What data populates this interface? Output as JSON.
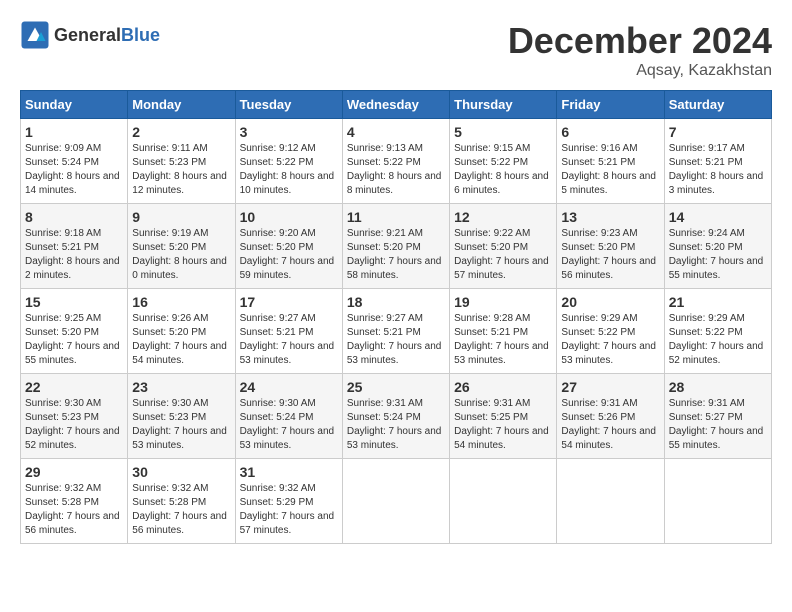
{
  "header": {
    "logo_general": "General",
    "logo_blue": "Blue",
    "month_year": "December 2024",
    "location": "Aqsay, Kazakhstan"
  },
  "weekdays": [
    "Sunday",
    "Monday",
    "Tuesday",
    "Wednesday",
    "Thursday",
    "Friday",
    "Saturday"
  ],
  "weeks": [
    [
      {
        "day": "1",
        "sunrise": "9:09 AM",
        "sunset": "5:24 PM",
        "daylight": "8 hours and 14 minutes."
      },
      {
        "day": "2",
        "sunrise": "9:11 AM",
        "sunset": "5:23 PM",
        "daylight": "8 hours and 12 minutes."
      },
      {
        "day": "3",
        "sunrise": "9:12 AM",
        "sunset": "5:22 PM",
        "daylight": "8 hours and 10 minutes."
      },
      {
        "day": "4",
        "sunrise": "9:13 AM",
        "sunset": "5:22 PM",
        "daylight": "8 hours and 8 minutes."
      },
      {
        "day": "5",
        "sunrise": "9:15 AM",
        "sunset": "5:22 PM",
        "daylight": "8 hours and 6 minutes."
      },
      {
        "day": "6",
        "sunrise": "9:16 AM",
        "sunset": "5:21 PM",
        "daylight": "8 hours and 5 minutes."
      },
      {
        "day": "7",
        "sunrise": "9:17 AM",
        "sunset": "5:21 PM",
        "daylight": "8 hours and 3 minutes."
      }
    ],
    [
      {
        "day": "8",
        "sunrise": "9:18 AM",
        "sunset": "5:21 PM",
        "daylight": "8 hours and 2 minutes."
      },
      {
        "day": "9",
        "sunrise": "9:19 AM",
        "sunset": "5:20 PM",
        "daylight": "8 hours and 0 minutes."
      },
      {
        "day": "10",
        "sunrise": "9:20 AM",
        "sunset": "5:20 PM",
        "daylight": "7 hours and 59 minutes."
      },
      {
        "day": "11",
        "sunrise": "9:21 AM",
        "sunset": "5:20 PM",
        "daylight": "7 hours and 58 minutes."
      },
      {
        "day": "12",
        "sunrise": "9:22 AM",
        "sunset": "5:20 PM",
        "daylight": "7 hours and 57 minutes."
      },
      {
        "day": "13",
        "sunrise": "9:23 AM",
        "sunset": "5:20 PM",
        "daylight": "7 hours and 56 minutes."
      },
      {
        "day": "14",
        "sunrise": "9:24 AM",
        "sunset": "5:20 PM",
        "daylight": "7 hours and 55 minutes."
      }
    ],
    [
      {
        "day": "15",
        "sunrise": "9:25 AM",
        "sunset": "5:20 PM",
        "daylight": "7 hours and 55 minutes."
      },
      {
        "day": "16",
        "sunrise": "9:26 AM",
        "sunset": "5:20 PM",
        "daylight": "7 hours and 54 minutes."
      },
      {
        "day": "17",
        "sunrise": "9:27 AM",
        "sunset": "5:21 PM",
        "daylight": "7 hours and 53 minutes."
      },
      {
        "day": "18",
        "sunrise": "9:27 AM",
        "sunset": "5:21 PM",
        "daylight": "7 hours and 53 minutes."
      },
      {
        "day": "19",
        "sunrise": "9:28 AM",
        "sunset": "5:21 PM",
        "daylight": "7 hours and 53 minutes."
      },
      {
        "day": "20",
        "sunrise": "9:29 AM",
        "sunset": "5:22 PM",
        "daylight": "7 hours and 53 minutes."
      },
      {
        "day": "21",
        "sunrise": "9:29 AM",
        "sunset": "5:22 PM",
        "daylight": "7 hours and 52 minutes."
      }
    ],
    [
      {
        "day": "22",
        "sunrise": "9:30 AM",
        "sunset": "5:23 PM",
        "daylight": "7 hours and 52 minutes."
      },
      {
        "day": "23",
        "sunrise": "9:30 AM",
        "sunset": "5:23 PM",
        "daylight": "7 hours and 53 minutes."
      },
      {
        "day": "24",
        "sunrise": "9:30 AM",
        "sunset": "5:24 PM",
        "daylight": "7 hours and 53 minutes."
      },
      {
        "day": "25",
        "sunrise": "9:31 AM",
        "sunset": "5:24 PM",
        "daylight": "7 hours and 53 minutes."
      },
      {
        "day": "26",
        "sunrise": "9:31 AM",
        "sunset": "5:25 PM",
        "daylight": "7 hours and 54 minutes."
      },
      {
        "day": "27",
        "sunrise": "9:31 AM",
        "sunset": "5:26 PM",
        "daylight": "7 hours and 54 minutes."
      },
      {
        "day": "28",
        "sunrise": "9:31 AM",
        "sunset": "5:27 PM",
        "daylight": "7 hours and 55 minutes."
      }
    ],
    [
      {
        "day": "29",
        "sunrise": "9:32 AM",
        "sunset": "5:28 PM",
        "daylight": "7 hours and 56 minutes."
      },
      {
        "day": "30",
        "sunrise": "9:32 AM",
        "sunset": "5:28 PM",
        "daylight": "7 hours and 56 minutes."
      },
      {
        "day": "31",
        "sunrise": "9:32 AM",
        "sunset": "5:29 PM",
        "daylight": "7 hours and 57 minutes."
      },
      null,
      null,
      null,
      null
    ]
  ]
}
